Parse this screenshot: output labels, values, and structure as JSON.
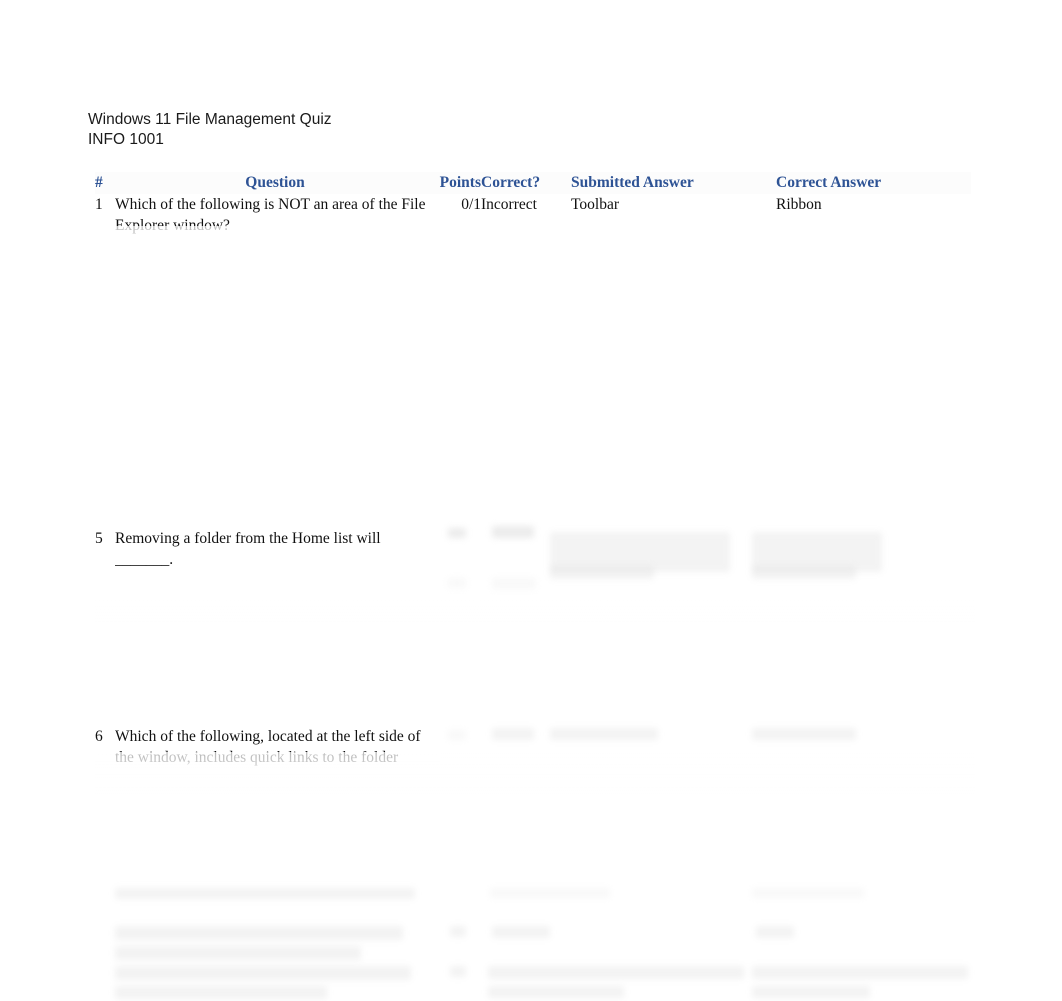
{
  "document": {
    "title": "Windows 11 File Management Quiz",
    "course_code": "INFO 1001"
  },
  "table": {
    "headers": {
      "number": "#",
      "question": "Question",
      "points": "Points",
      "correct": "Correct?",
      "submitted_answer": "Submitted Answer",
      "correct_answer": "Correct Answer"
    },
    "accent_color": "#2E5395",
    "text_color": "#111111",
    "rows": [
      {
        "number": "1",
        "question": "Which of the following is NOT an area of the File Explorer window?",
        "points": "0/1",
        "correct": "Incorrect",
        "submitted_answer": "Toolbar",
        "correct_answer": "Ribbon"
      },
      {
        "number": "5",
        "question": "Removing a folder from the Home list will _______.",
        "points": "",
        "correct": "",
        "submitted_answer": "",
        "correct_answer": ""
      },
      {
        "number": "6",
        "question": "Which of the following, located at the left side of the window, includes quick links to the folder",
        "points": "",
        "correct": "",
        "submitted_answer": "",
        "correct_answer": ""
      }
    ]
  }
}
